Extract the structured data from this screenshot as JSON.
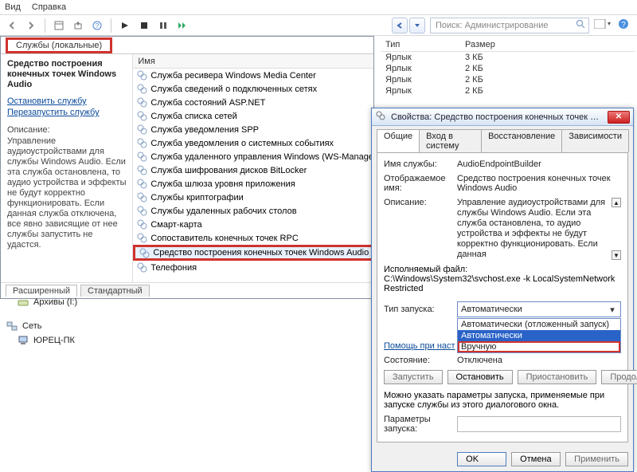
{
  "menu": {
    "view": "Вид",
    "help": "Справка"
  },
  "search": {
    "placeholder": "Поиск: Администрирование"
  },
  "services": {
    "tab_local": "Службы (локальные)",
    "title": "Средство построения конечных точек Windows Audio",
    "link_stop": "Остановить службу",
    "link_restart": "Перезапустить службу",
    "desc_label": "Описание:",
    "desc": "Управление аудиоустройствами для службы Windows Audio. Если эта служба остановлена, то аудио устройства и эффекты не будут корректно функционировать. Если данная служба отключена, все явно зависящие от нее службы запустить не удастся.",
    "col_name": "Имя",
    "ext_tab": "Расширенный",
    "std_tab": "Стандартный",
    "items": [
      "Служба ресивера Windows Media Center",
      "Служба сведений о подключенных сетях",
      "Служба состояний ASP.NET",
      "Служба списка сетей",
      "Служба уведомления SPP",
      "Служба уведомления о системных событиях",
      "Служба удаленного управления Windows (WS-Manage",
      "Служба шифрования дисков BitLocker",
      "Служба шлюза уровня приложения",
      "Службы криптографии",
      "Службы удаленных рабочих столов",
      "Смарт-карта",
      "Сопоставитель конечных точек RPC",
      "Средство построения конечных точек Windows Audio",
      "Телефония"
    ]
  },
  "explorer": {
    "col_type": "Тип",
    "col_size": "Размер",
    "rows": [
      {
        "type": "Ярлык",
        "size": "3 КБ"
      },
      {
        "type": "Ярлык",
        "size": "2 КБ"
      },
      {
        "type": "Ярлык",
        "size": "2 КБ"
      },
      {
        "type": "Ярлык",
        "size": "2 КБ"
      }
    ]
  },
  "tree": {
    "archives": "Архивы (I:)",
    "network": "Сеть",
    "pc": "ЮРЕЦ-ПК"
  },
  "dialog": {
    "title": "Свойства: Средство построения конечных точек Windows Aud...",
    "tabs": {
      "general": "Общие",
      "logon": "Вход в систему",
      "recovery": "Восстановление",
      "deps": "Зависимости"
    },
    "name_label": "Имя службы:",
    "name_value": "AudioEndpointBuilder",
    "display_label": "Отображаемое имя:",
    "display_value": "Средство построения конечных точек Windows Audio",
    "desc_label": "Описание:",
    "desc_value": "Управление аудиоустройствами для службы Windows Audio. Если эта служба остановлена, то аудио устройства и эффекты не будут корректно функционировать. Если данная",
    "exe_label": "Исполняемый файл:",
    "exe_value": "C:\\Windows\\System32\\svchost.exe -k LocalSystemNetworkRestricted",
    "startup_label": "Тип запуска:",
    "startup_value": "Автоматически",
    "dd": {
      "opt1": "Автоматически (отложенный запуск)",
      "opt2": "Автоматически",
      "opt3": "Вручную"
    },
    "help_link": "Помощь при наст",
    "state_label": "Состояние:",
    "state_value": "Отключена",
    "btn_start": "Запустить",
    "btn_stop": "Остановить",
    "btn_pause": "Приостановить",
    "btn_resume": "Продолжить",
    "params_hint": "Можно указать параметры запуска, применяемые при запуске службы из этого диалогового окна.",
    "params_label": "Параметры запуска:",
    "ok": "OK",
    "cancel": "Отмена",
    "apply": "Применить"
  }
}
